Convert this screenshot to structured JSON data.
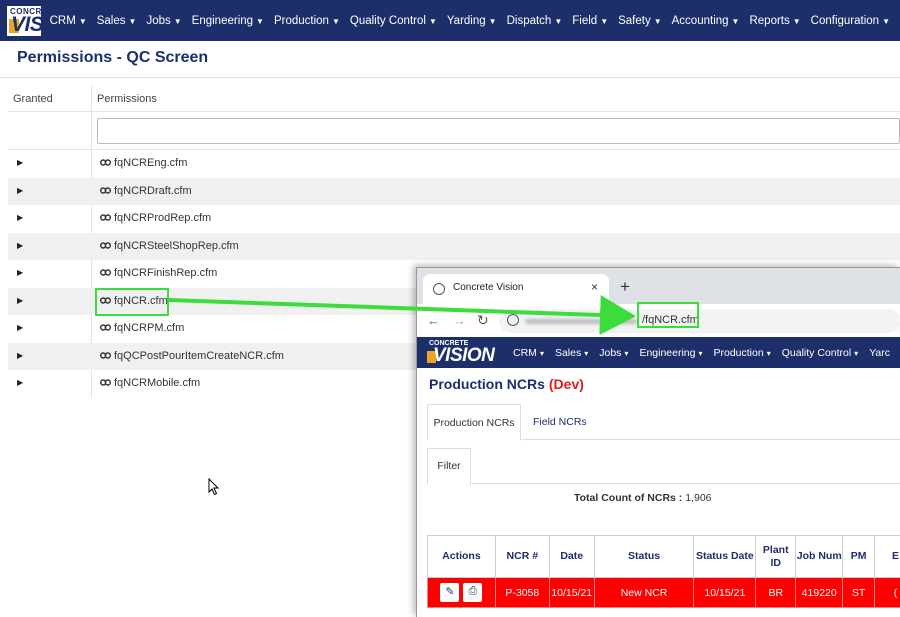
{
  "app": {
    "logo_small": "CONCRETE",
    "logo_big": "VISION",
    "menu": [
      "CRM",
      "Sales",
      "Jobs",
      "Engineering",
      "Production",
      "Quality Control",
      "Yarding",
      "Dispatch",
      "Field",
      "Safety",
      "Accounting",
      "Reports",
      "Configuration"
    ]
  },
  "page": {
    "title": "Permissions - QC Screen"
  },
  "grid": {
    "headers": {
      "granted": "Granted",
      "permissions": "Permissions"
    },
    "filter_placeholder": "",
    "rows": [
      "fqNCREng.cfm",
      "fqNCRDraft.cfm",
      "fqNCRProdRep.cfm",
      "fqNCRSteelShopRep.cfm",
      "fqNCRFinishRep.cfm",
      "fqNCR.cfm",
      "fqNCRPM.cfm",
      "fqQCPostPourItemCreateNCR.cfm",
      "fqNCRMobile.cfm"
    ],
    "highlighted_row": "fqNCR.cfm"
  },
  "browser": {
    "tab_title": "Concrete Vision",
    "tab_close": "×",
    "new_tab": "+",
    "url_path": "/fqNCR.cfm",
    "menu": [
      "CRM",
      "Sales",
      "Jobs",
      "Engineering",
      "Production",
      "Quality Control",
      "Yarc"
    ],
    "page_title": "Production NCRs",
    "page_env": "(Dev)",
    "tabs": [
      "Production NCRs",
      "Field NCRs"
    ],
    "filter_tab": "Filter",
    "count_label": "Total Count of NCRs :",
    "count_value": "1,906",
    "table": {
      "headers": [
        "Actions",
        "NCR #",
        "Date",
        "Status",
        "Status Date",
        "Plant ID",
        "Job Num",
        "PM",
        "E"
      ],
      "rows": [
        [
          "",
          "P-3058",
          "10/15/21",
          "New NCR",
          "10/15/21",
          "BR",
          "419220",
          "ST",
          "("
        ]
      ]
    }
  },
  "colors": {
    "nav": "#1c2f6b",
    "accent_orange": "#f3a21b",
    "highlight_green": "#3ddc3d",
    "row_red": "#ff0000",
    "dev_red": "#e01b1b"
  }
}
